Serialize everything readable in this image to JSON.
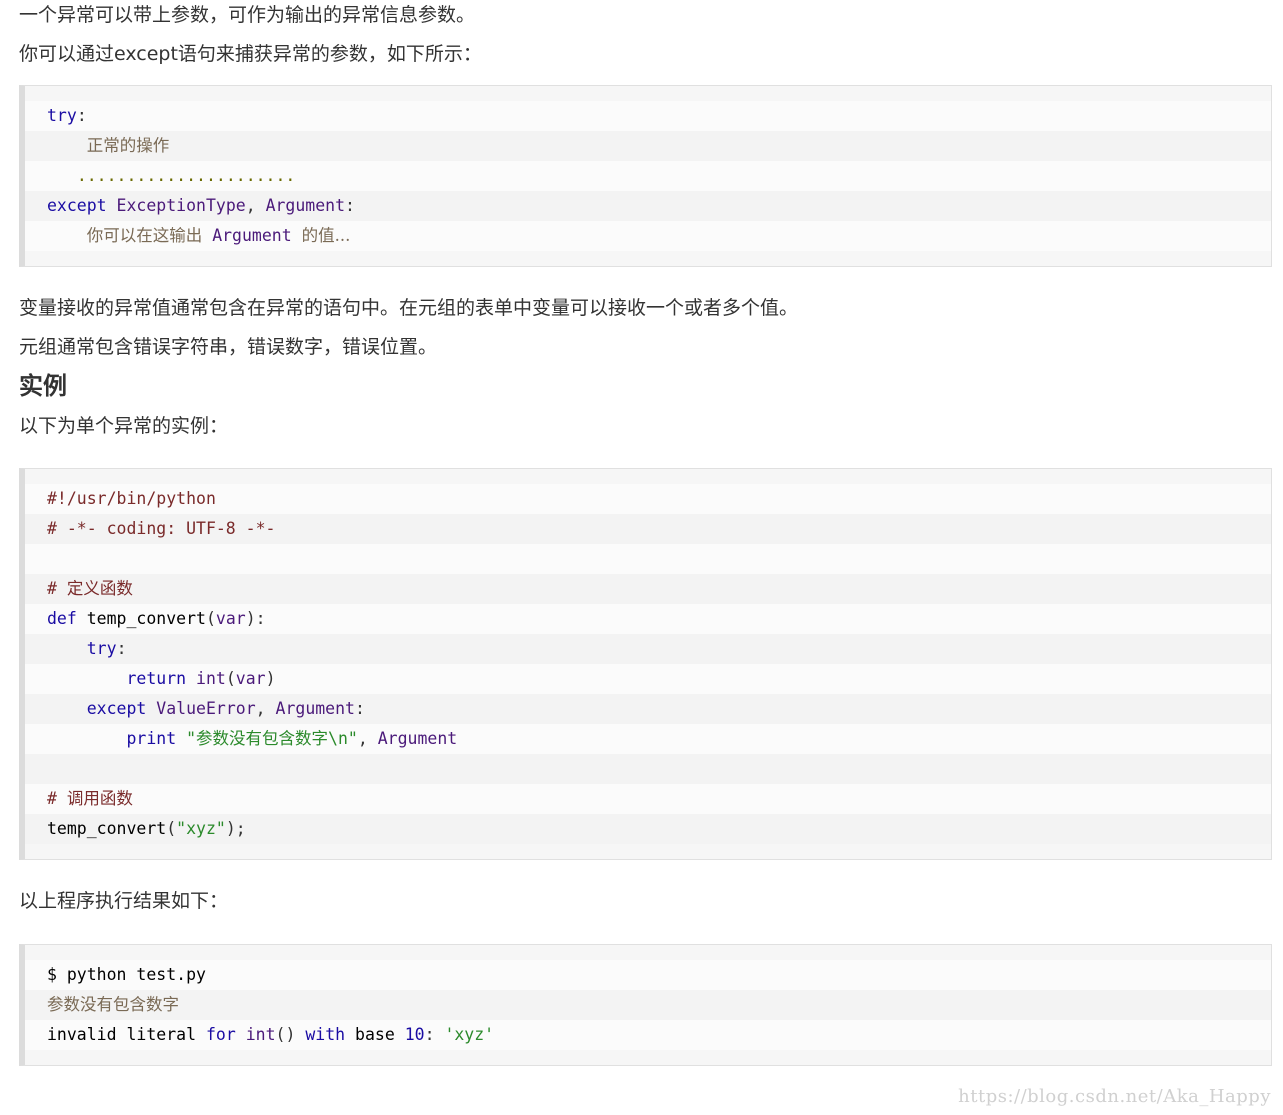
{
  "intro": {
    "line1": "一个异常可以带上参数，可作为输出的异常信息参数。",
    "line2": "你可以通过except语句来捕获异常的参数，如下所示："
  },
  "code1": {
    "l1_kw": "try",
    "l1_p": ":",
    "l2_cn": "正常的操作",
    "l3_dots": "......................",
    "l4_kw": "except",
    "l4_cls": "ExceptionType",
    "l4_p1": ", ",
    "l4_arg": "Argument",
    "l4_p2": ":",
    "l5_cn1": "你可以在这输出",
    "l5_arg": "Argument",
    "l5_cn2": "的值..."
  },
  "middle": {
    "line1": "变量接收的异常值通常包含在异常的语句中。在元组的表单中变量可以接收一个或者多个值。",
    "line2": "元组通常包含错误字符串，错误数字，错误位置。"
  },
  "example": {
    "heading": "实例",
    "intro": "以下为单个异常的实例："
  },
  "code2": {
    "l1": "#!/usr/bin/python",
    "l2": "# -*- coding: UTF-8 -*-",
    "l4_hash": "# ",
    "l4_cn": "定义函数",
    "l5_kw": "def",
    "l5_name": "temp_convert",
    "l5_p1": "(",
    "l5_var": "var",
    "l5_p2": "):",
    "l6_kw": "try",
    "l6_p": ":",
    "l7_kw": "return",
    "l7_fn": "int",
    "l7_p1": "(",
    "l7_var": "var",
    "l7_p2": ")",
    "l8_kw": "except",
    "l8_cls": "ValueError",
    "l8_p1": ", ",
    "l8_arg": "Argument",
    "l8_p2": ":",
    "l9_kw": "print",
    "l9_q1": "\"",
    "l9_cn": "参数没有包含数字",
    "l9_esc": "\\n",
    "l9_q2": "\"",
    "l9_p": ", ",
    "l9_arg": "Argument",
    "l11_hash": "# ",
    "l11_cn": "调用函数",
    "l12_name": "temp_convert",
    "l12_p1": "(",
    "l12_str": "\"xyz\"",
    "l12_p2": ");"
  },
  "result": {
    "intro": "以上程序执行结果如下："
  },
  "code3": {
    "l1": "$ python test.py",
    "l2_cn": "参数没有包含数字",
    "l3_a": "invalid literal ",
    "l3_for": "for",
    "l3_b": " ",
    "l3_int": "int",
    "l3_c": "() ",
    "l3_with": "with",
    "l3_d": " base ",
    "l3_num": "10",
    "l3_e": ": ",
    "l3_str": "'xyz'"
  },
  "watermark": "https://blog.csdn.net/Aka_Happy"
}
